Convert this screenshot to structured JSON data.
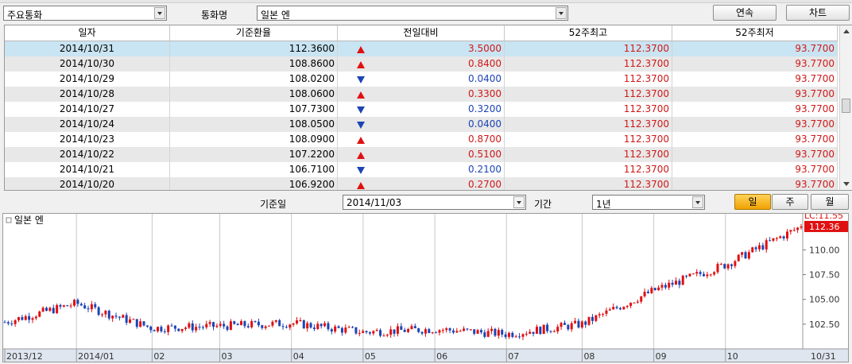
{
  "toolbar": {
    "category_value": "주요통화",
    "currency_label": "통화명",
    "currency_value": "일본 엔",
    "continuous_button": "연속",
    "chart_button": "차트"
  },
  "grid": {
    "headers": [
      "일자",
      "기준환율",
      "전일대비",
      "52주최고",
      "52주최저"
    ],
    "rows": [
      {
        "date": "2014/10/31",
        "rate": "112.3600",
        "dir": "up",
        "change": "3.5000",
        "high": "112.3700",
        "low": "93.7700"
      },
      {
        "date": "2014/10/30",
        "rate": "108.8600",
        "dir": "up",
        "change": "0.8400",
        "high": "112.3700",
        "low": "93.7700"
      },
      {
        "date": "2014/10/29",
        "rate": "108.0200",
        "dir": "dn",
        "change": "0.0400",
        "high": "112.3700",
        "low": "93.7700"
      },
      {
        "date": "2014/10/28",
        "rate": "108.0600",
        "dir": "up",
        "change": "0.3300",
        "high": "112.3700",
        "low": "93.7700"
      },
      {
        "date": "2014/10/27",
        "rate": "107.7300",
        "dir": "dn",
        "change": "0.3200",
        "high": "112.3700",
        "low": "93.7700"
      },
      {
        "date": "2014/10/24",
        "rate": "108.0500",
        "dir": "dn",
        "change": "0.0400",
        "high": "112.3700",
        "low": "93.7700"
      },
      {
        "date": "2014/10/23",
        "rate": "108.0900",
        "dir": "up",
        "change": "0.8700",
        "high": "112.3700",
        "low": "93.7700"
      },
      {
        "date": "2014/10/22",
        "rate": "107.2200",
        "dir": "up",
        "change": "0.5100",
        "high": "112.3700",
        "low": "93.7700"
      },
      {
        "date": "2014/10/21",
        "rate": "106.7100",
        "dir": "dn",
        "change": "0.2100",
        "high": "112.3700",
        "low": "93.7700"
      },
      {
        "date": "2014/10/20",
        "rate": "106.9200",
        "dir": "up",
        "change": "0.2700",
        "high": "112.3700",
        "low": "93.7700"
      }
    ]
  },
  "filter": {
    "base_date_label": "기준일",
    "base_date_value": "2014/11/03",
    "period_label": "기간",
    "period_value": "1년",
    "day_button": "일",
    "week_button": "주",
    "month_button": "월"
  },
  "chart": {
    "legend": "일본 엔",
    "lc_label": "LC:11.55",
    "last_price": "112.36",
    "y_ticks": [
      "110.00",
      "107.50",
      "105.00",
      "102.50"
    ],
    "x_ticks": [
      "2013/12",
      "2014/01",
      "02",
      "03",
      "04",
      "05",
      "06",
      "07",
      "08",
      "09",
      "10",
      "10/31"
    ],
    "colors": {
      "up": "#e01010",
      "down": "#1c44b5",
      "grid": "#c8c8c8"
    }
  },
  "chart_data": {
    "type": "line",
    "title": "",
    "xlabel": "",
    "ylabel": "",
    "x": [
      "2013/12",
      "2014/01",
      "2014/02",
      "2014/03",
      "2014/04",
      "2014/05",
      "2014/06",
      "2014/07",
      "2014/08",
      "2014/09",
      "2014/10",
      "2014/10/31"
    ],
    "series": [
      {
        "name": "일본 엔",
        "values": [
          102.7,
          104.6,
          102.1,
          102.3,
          102.6,
          101.7,
          102.0,
          101.5,
          102.5,
          105.9,
          108.5,
          112.36
        ]
      }
    ],
    "ylim": [
      100.0,
      113.0
    ],
    "y_ticks": [
      102.5,
      105.0,
      107.5,
      110.0
    ]
  }
}
